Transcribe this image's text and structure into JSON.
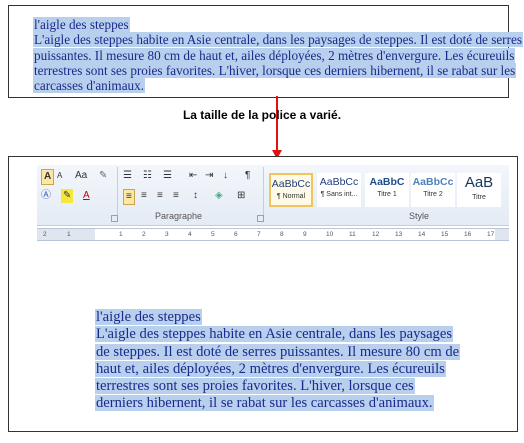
{
  "top_box": {
    "lines": [
      "l'aigle des steppes",
      "L'aigle des steppes habite en Asie centrale, dans les paysages de steppes. Il est doté de serres",
      "puissantes. Il mesure 80 cm de haut et, ailes déployées, 2 mètres d'envergure. Les écureuils",
      "terrestres sont ses proies favorites. L'hiver, lorsque ces derniers hibernent, il se rabat sur les",
      "carcasses d'animaux."
    ]
  },
  "caption": "La taille de la police a varié.",
  "ribbon": {
    "paragraph_label": "Paragraphe",
    "style_label": "Style",
    "styles": [
      {
        "sample": "AaBbCc",
        "name": "¶ Normal"
      },
      {
        "sample": "AaBbCc",
        "name": "¶ Sans int..."
      },
      {
        "sample": "AaBbC",
        "name": "Titre 1"
      },
      {
        "sample": "AaBbCc",
        "name": "Titre 2"
      },
      {
        "sample": "AaB",
        "name": "Titre"
      }
    ],
    "font_buttons": [
      "A",
      "A",
      "Aa"
    ],
    "pilcrow": "¶"
  },
  "ruler_marks": [
    "2",
    "1",
    "1",
    "2",
    "3",
    "4",
    "5",
    "6",
    "7",
    "8",
    "9",
    "10",
    "11",
    "12",
    "13",
    "14",
    "15",
    "16",
    "17"
  ],
  "document": {
    "lines": [
      "l'aigle des steppes",
      "L'aigle des steppes habite en Asie centrale, dans les paysages",
      "de steppes. Il est doté de serres puissantes. Il mesure 80 cm de",
      "haut et, ailes déployées, 2 mètres d'envergure. Les écureuils",
      "terrestres sont ses proies favorites. L'hiver, lorsque ces",
      "derniers hibernent, il se rabat sur les carcasses d'animaux."
    ]
  },
  "colors": {
    "selection": "#b9cfee",
    "arrow": "#e01010",
    "text": "#1a2a8a"
  }
}
